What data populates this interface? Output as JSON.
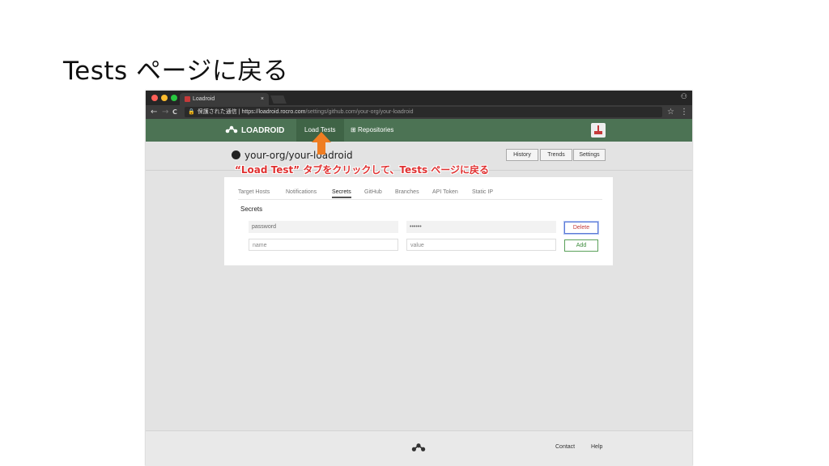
{
  "slide": {
    "title": "Tests ページに戻る"
  },
  "browser": {
    "tab": {
      "title": "Loadroid",
      "close": "×"
    },
    "address": {
      "security": "保護された通信",
      "separator": "|",
      "url_host": "https://loadroid.rocro.com",
      "url_path": "/settings/github.com/your-org/your-loadroid"
    },
    "nav": {
      "back": "←",
      "forward": "→",
      "reload": "C",
      "star": "☆",
      "menu": "⋮"
    }
  },
  "app": {
    "brand": "LOADROID",
    "nav": [
      {
        "label": "Load Tests"
      },
      {
        "label": "Repositories",
        "icon": "⊞"
      }
    ],
    "repo_name": "your-org/your-loadroid",
    "header_buttons": [
      "History",
      "Trends",
      "Settings"
    ],
    "tabs": [
      "Target Hosts",
      "Notifications",
      "Secrets",
      "GitHub",
      "Branches",
      "API Token",
      "Static IP"
    ],
    "active_tab": "Secrets",
    "section_title": "Secrets",
    "secrets_row": {
      "name": "password",
      "value": "••••••",
      "button": "Delete"
    },
    "new_row": {
      "name_placeholder": "name",
      "value_placeholder": "value",
      "button": "Add"
    },
    "footer": {
      "links": [
        "Contact",
        "Help"
      ]
    }
  },
  "annotation": {
    "text": "“Load Test” タブをクリックして、Tests ページに戻る",
    "color": "#e03030",
    "arrow_color": "#ef7d22"
  },
  "colors": {
    "nav_green": "#4c7354",
    "accent_red": "#c53a3a"
  }
}
